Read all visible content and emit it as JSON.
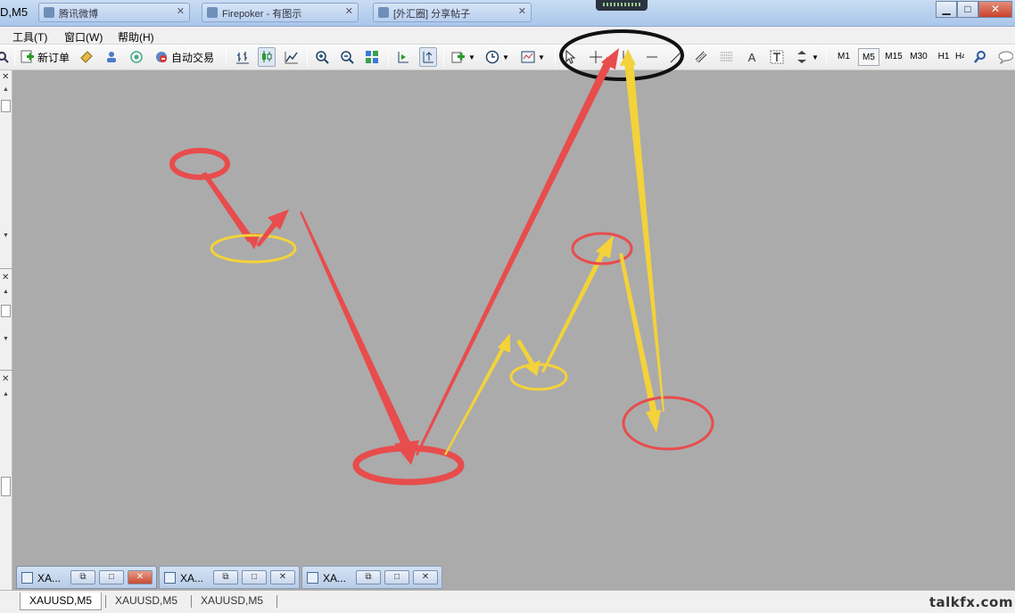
{
  "window": {
    "title": "D,M5",
    "os_tabs": [
      "腾讯微博",
      "Firepoker - 有图示",
      "[外汇圈] 分享帖子"
    ],
    "buttons": {
      "minimize": "▁",
      "maximize": "□",
      "close": "✕"
    }
  },
  "menu": {
    "items": [
      "工具(T)",
      "窗口(W)",
      "帮助(H)"
    ]
  },
  "toolbar": {
    "new_order_label": "新订单",
    "auto_trade_label": "自动交易",
    "icons": [
      "market-watch-icon",
      "new-order-icon",
      "metaeditor-icon",
      "navigator-icon",
      "signals-icon",
      "auto-trading-icon",
      "bar-chart-icon",
      "candlestick-icon",
      "line-chart-icon",
      "zoom-in-icon",
      "zoom-out-icon",
      "tile-windows-icon",
      "chart-shift-icon",
      "autoscroll-icon",
      "indicators-icon",
      "periods-icon",
      "templates-icon",
      "cursor-icon",
      "crosshair-icon",
      "vertical-line-icon",
      "horizontal-line-icon",
      "trendline-icon",
      "equidistant-channel-icon",
      "fibonacci-icon",
      "text-icon",
      "text-label-icon",
      "arrows-icon",
      "search-icon",
      "chat-icon"
    ],
    "text_tool": "A",
    "timeframes": [
      "M1",
      "M5",
      "M15",
      "M30",
      "H1",
      "H4"
    ],
    "active_timeframe": "M5"
  },
  "minimized_windows": [
    {
      "title": "XA...",
      "restore": "⧉",
      "maximize": "□",
      "close": "✕",
      "active": true
    },
    {
      "title": "XA...",
      "restore": "⧉",
      "maximize": "□",
      "close": "✕",
      "active": false
    },
    {
      "title": "XA...",
      "restore": "⧉",
      "maximize": "□",
      "close": "✕",
      "active": false
    }
  ],
  "chart_tabs": [
    "XAUUSD,M5",
    "XAUUSD,M5",
    "XAUUSD,M5"
  ],
  "active_chart_tab": 0,
  "watermark": "talkfx.com",
  "annotation_colors": {
    "red": "#e84c4c",
    "yellow": "#f3d23a",
    "black": "#111111",
    "workspace": "#ababab"
  }
}
